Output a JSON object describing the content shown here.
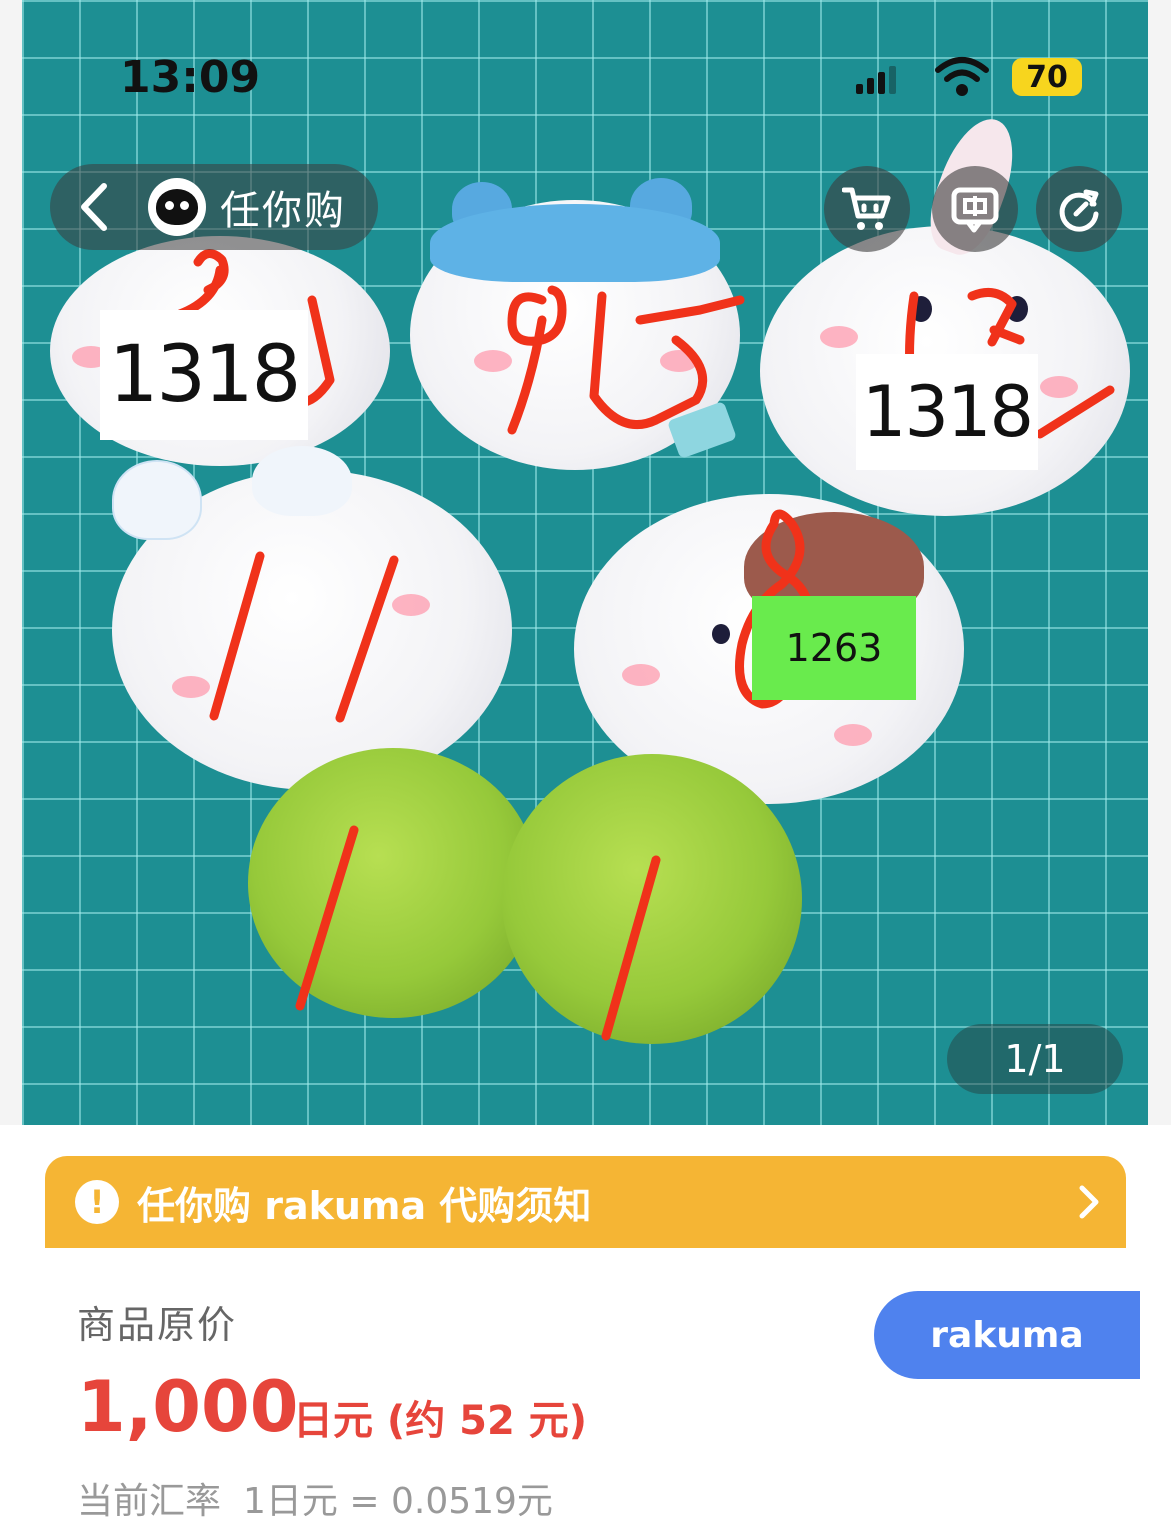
{
  "status_bar": {
    "time": "13:09",
    "battery": "70",
    "signal_icon": "cellular-signal-icon",
    "wifi_icon": "wifi-icon"
  },
  "nav": {
    "back_icon": "chevron-left-icon",
    "app_name": "任你购",
    "cart_icon": "cart-icon",
    "chat_icon": "chat-icon",
    "refresh_icon": "refresh-icon"
  },
  "photo": {
    "labels": [
      "1318",
      "1318",
      "1263"
    ],
    "pager": "1/1"
  },
  "notice": {
    "icon": "exclamation-circle-icon",
    "text": "任你购 rakuma 代购须知",
    "arrow_icon": "chevron-right-icon",
    "color": "#f5b534"
  },
  "price": {
    "label": "商品原价",
    "amount": "1,000",
    "unit_and_conversion": "日元 (约 52 元)",
    "rate_label": "当前汇率",
    "rate_value": "1日元 = 0.0519元",
    "platform": "rakuma",
    "price_color": "#e6453b",
    "platform_color": "#4f82ee"
  }
}
